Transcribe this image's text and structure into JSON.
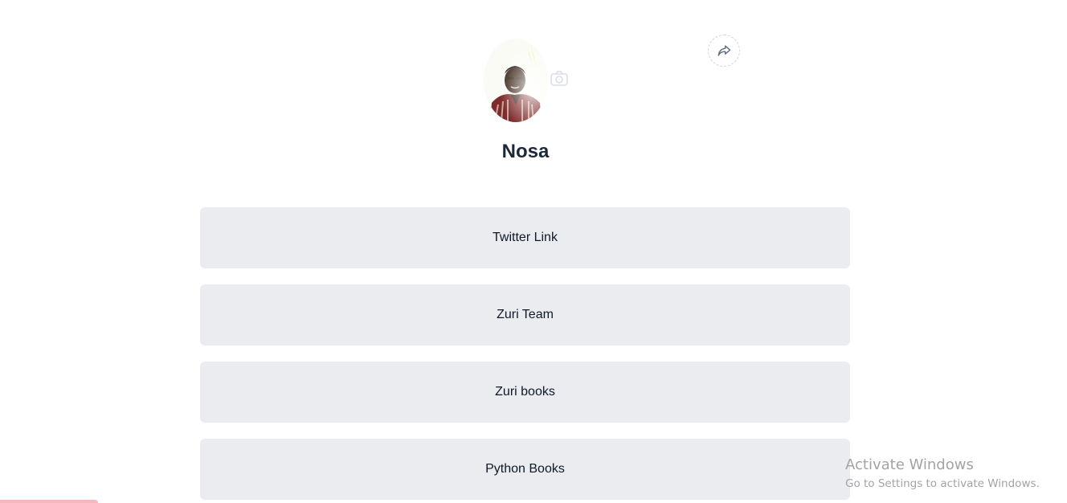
{
  "profile": {
    "name": "Nosa",
    "avatar_alt": "profile photo"
  },
  "share": {
    "icon": "share-icon"
  },
  "links": [
    {
      "label": "Twitter Link"
    },
    {
      "label": "Zuri Team"
    },
    {
      "label": "Zuri books"
    },
    {
      "label": "Python Books"
    }
  ],
  "watermark": {
    "title": "Activate Windows",
    "subtitle": "Go to Settings to activate Windows."
  },
  "colors": {
    "link_background": "#eaecf0",
    "text": "#101828",
    "name": "#1d2939"
  }
}
